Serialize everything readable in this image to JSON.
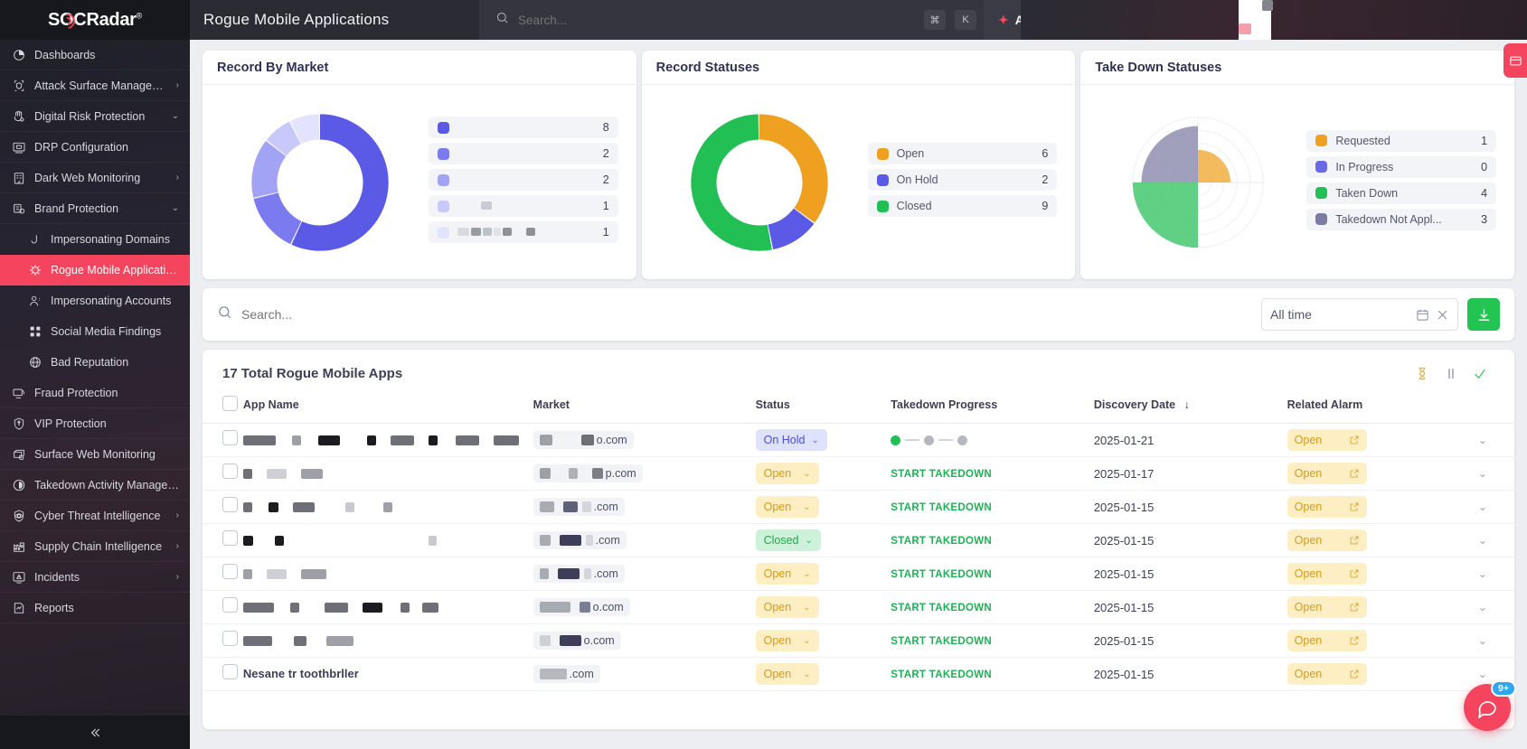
{
  "brand": {
    "name": "SOCRadar",
    "registered": "®",
    "accent": "#f4445e"
  },
  "header": {
    "page_title": "Rogue Mobile Applications",
    "search_placeholder": "Search...",
    "kbd_cmd": "⌘",
    "kbd_k": "K",
    "ai_label": "AI",
    "search_icon": "search-icon"
  },
  "sidebar": {
    "items": [
      {
        "label": "Dashboards",
        "icon": "dashboard-icon",
        "chevron": "",
        "level": 0,
        "active": false
      },
      {
        "label": "Attack Surface Management",
        "icon": "shield-scan-icon",
        "chevron": "›",
        "level": 0,
        "active": false
      },
      {
        "label": "Digital Risk Protection",
        "icon": "hand-icon",
        "chevron": "⌄",
        "level": 0,
        "active": false
      },
      {
        "label": "DRP Configuration",
        "icon": "monitor-icon",
        "chevron": "",
        "level": 0,
        "active": false
      },
      {
        "label": "Dark Web Monitoring",
        "icon": "darkweb-icon",
        "chevron": "›",
        "level": 0,
        "active": false
      },
      {
        "label": "Brand Protection",
        "icon": "brand-icon",
        "chevron": "⌄",
        "level": 0,
        "active": false
      },
      {
        "label": "Impersonating Domains",
        "icon": "domain-icon",
        "chevron": "",
        "level": 1,
        "active": false
      },
      {
        "label": "Rogue Mobile Applications",
        "icon": "bug-icon",
        "chevron": "",
        "level": 1,
        "active": true
      },
      {
        "label": "Impersonating Accounts",
        "icon": "user-icon",
        "chevron": "",
        "level": 1,
        "active": false
      },
      {
        "label": "Social Media Findings",
        "icon": "grid-icon",
        "chevron": "",
        "level": 1,
        "active": false
      },
      {
        "label": "Bad Reputation",
        "icon": "globe-icon",
        "chevron": "",
        "level": 1,
        "active": false
      },
      {
        "label": "Fraud Protection",
        "icon": "fraud-icon",
        "chevron": "",
        "level": 0,
        "active": false
      },
      {
        "label": "VIP Protection",
        "icon": "vip-shield-icon",
        "chevron": "",
        "level": 0,
        "active": false
      },
      {
        "label": "Surface Web Monitoring",
        "icon": "web-lock-icon",
        "chevron": "",
        "level": 0,
        "active": false
      },
      {
        "label": "Takedown Activity Management",
        "icon": "clock-icon",
        "chevron": "",
        "level": 0,
        "active": false
      },
      {
        "label": "Cyber Threat Intelligence",
        "icon": "eye-shield-icon",
        "chevron": "›",
        "level": 0,
        "active": false
      },
      {
        "label": "Supply Chain Intelligence",
        "icon": "factory-icon",
        "chevron": "›",
        "level": 0,
        "active": false
      },
      {
        "label": "Incidents",
        "icon": "alert-monitor-icon",
        "chevron": "›",
        "level": 0,
        "active": false
      },
      {
        "label": "Reports",
        "icon": "report-icon",
        "chevron": "",
        "level": 0,
        "active": false
      }
    ],
    "collapse_icon": "collapse-chevrons-icon"
  },
  "chart_data": [
    {
      "type": "pie",
      "title": "Record By Market",
      "categories": [
        "",
        "",
        "",
        "",
        ""
      ],
      "labels_redacted": true,
      "values": [
        8,
        2,
        2,
        1,
        1
      ],
      "colors": [
        "#5b5ae6",
        "#7b7bef",
        "#a3a3f5",
        "#c8c8fa",
        "#e3e3fd"
      ],
      "legend": "right",
      "donut": true
    },
    {
      "type": "pie",
      "title": "Record Statuses",
      "categories": [
        "Open",
        "On Hold",
        "Closed"
      ],
      "values": [
        6,
        2,
        9
      ],
      "colors": [
        "#f0a020",
        "#5b5ae6",
        "#22bf55"
      ],
      "legend": "right",
      "donut": true
    },
    {
      "type": "bar",
      "title": "Take Down Statuses",
      "subtype": "polar-area",
      "categories": [
        "Requested",
        "In Progress",
        "Taken Down",
        "Takedown Not Appl..."
      ],
      "values": [
        1,
        0,
        4,
        3
      ],
      "colors": [
        "#f0a020",
        "#6a6ae8",
        "#22bf55",
        "#7c7ca3"
      ],
      "legend": "right",
      "grid": true
    }
  ],
  "filters": {
    "search_placeholder": "Search...",
    "search_icon": "search-icon",
    "date_value": "All time",
    "calendar_icon": "calendar-icon",
    "clear_icon": "close-icon",
    "download_icon": "download-icon"
  },
  "table": {
    "title": "17 Total Rogue Mobile Apps",
    "actions": [
      {
        "name": "hourglass-icon",
        "color": "#e8b43a"
      },
      {
        "name": "pause-icon",
        "color": "#7c7ca3"
      },
      {
        "name": "check-icon",
        "color": "#22bf55"
      }
    ],
    "columns": [
      "App Name",
      "Market",
      "Status",
      "Takedown Progress",
      "Discovery Date",
      "Related Alarm"
    ],
    "sort_column": "Discovery Date",
    "sort_arrow": "↓",
    "rows": [
      {
        "app_redacted": true,
        "market": "o.com",
        "status": "On Hold",
        "status_kind": "hold",
        "takedown": "progress",
        "date": "2025-01-21",
        "alarm": "Open"
      },
      {
        "app_redacted": true,
        "market": "p.com",
        "status": "Open",
        "status_kind": "open",
        "takedown": "START TAKEDOWN",
        "date": "2025-01-17",
        "alarm": "Open"
      },
      {
        "app_redacted": true,
        "market": ".com",
        "status": "Open",
        "status_kind": "open",
        "takedown": "START TAKEDOWN",
        "date": "2025-01-15",
        "alarm": "Open"
      },
      {
        "app_redacted": true,
        "market": ".com",
        "status": "Closed",
        "status_kind": "closed",
        "takedown": "START TAKEDOWN",
        "date": "2025-01-15",
        "alarm": "Open"
      },
      {
        "app_redacted": true,
        "market": ".com",
        "status": "Open",
        "status_kind": "open",
        "takedown": "START TAKEDOWN",
        "date": "2025-01-15",
        "alarm": "Open"
      },
      {
        "app_redacted": true,
        "market": "o.com",
        "status": "Open",
        "status_kind": "open",
        "takedown": "START TAKEDOWN",
        "date": "2025-01-15",
        "alarm": "Open"
      },
      {
        "app_redacted": true,
        "market": "o.com",
        "status": "Open",
        "status_kind": "open",
        "takedown": "START TAKEDOWN",
        "date": "2025-01-15",
        "alarm": "Open"
      },
      {
        "app_redacted": false,
        "app_name": "Nesane tr toothbrller",
        "market": ".com",
        "status": "Open",
        "status_kind": "open",
        "takedown": "START TAKEDOWN",
        "date": "2025-01-15",
        "alarm": "Open"
      }
    ],
    "expand_icon": "chevron-down-icon",
    "external-link_icon": "external-link-icon"
  },
  "floating": {
    "side_tab_icon": "panel-icon",
    "chat_icon": "chat-icon",
    "chat_badge": "9+"
  }
}
